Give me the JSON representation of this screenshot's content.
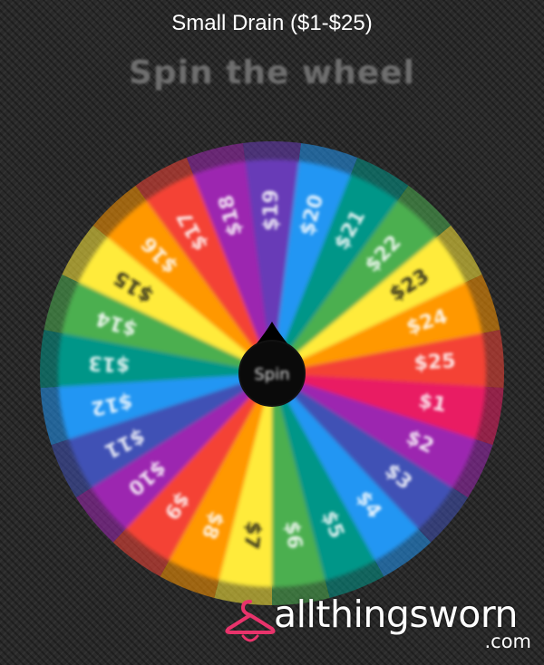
{
  "header": {
    "title": "Small Drain ($1-$25)",
    "subtitle": "Spin the wheel"
  },
  "wheel": {
    "center_button_label": "Spin",
    "pointer_icon": "pointer-drop-icon",
    "segments": [
      {
        "label": "$19",
        "color": "#673ab7"
      },
      {
        "label": "$20",
        "color": "#2196f3"
      },
      {
        "label": "$21",
        "color": "#009688"
      },
      {
        "label": "$22",
        "color": "#4caf50"
      },
      {
        "label": "$23",
        "color": "#ffeb3b"
      },
      {
        "label": "$24",
        "color": "#ff9800"
      },
      {
        "label": "$25",
        "color": "#f44336"
      },
      {
        "label": "$1",
        "color": "#e91e63"
      },
      {
        "label": "$2",
        "color": "#9c27b0"
      },
      {
        "label": "$3",
        "color": "#3f51b5"
      },
      {
        "label": "$4",
        "color": "#2196f3"
      },
      {
        "label": "$5",
        "color": "#009688"
      },
      {
        "label": "$6",
        "color": "#4caf50"
      },
      {
        "label": "$7",
        "color": "#ffeb3b"
      },
      {
        "label": "$8",
        "color": "#ff9800"
      },
      {
        "label": "$9",
        "color": "#f44336"
      },
      {
        "label": "$10",
        "color": "#9c27b0"
      },
      {
        "label": "$11",
        "color": "#3f51b5"
      },
      {
        "label": "$12",
        "color": "#2196f3"
      },
      {
        "label": "$13",
        "color": "#009688"
      },
      {
        "label": "$14",
        "color": "#4caf50"
      },
      {
        "label": "$15",
        "color": "#ffeb3b"
      },
      {
        "label": "$16",
        "color": "#ff9800"
      },
      {
        "label": "$17",
        "color": "#f44336"
      },
      {
        "label": "$18",
        "color": "#9c27b0"
      }
    ]
  },
  "watermark": {
    "brand": "allthingsworn",
    "tld": ".com",
    "icon": "hanger-icon",
    "accent": "#e8336b"
  }
}
